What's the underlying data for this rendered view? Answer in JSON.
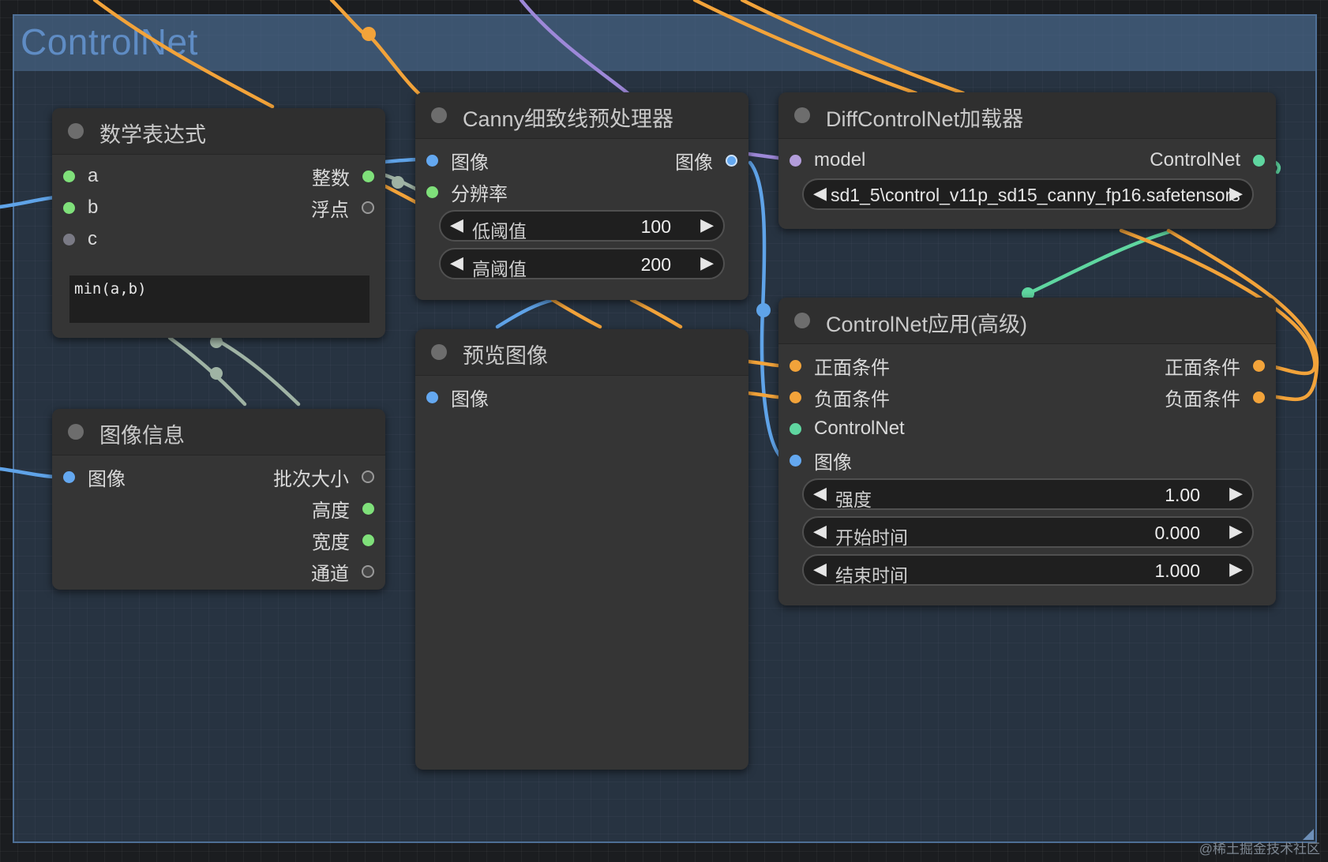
{
  "colors": {
    "background": "#1b1d20",
    "group_fill": "#3c5878",
    "group_title": "#5f8cc4",
    "node_body": "#353535",
    "node_header": "#2f2f2f",
    "slot_int": "#7fe07a",
    "slot_float": "#454545",
    "slot_image": "#64a8f0",
    "slot_model": "#b39ddb",
    "slot_conditioning": "#f2a33a",
    "slot_controlnet": "#5fd6a0",
    "wire_orange": "#f2a33a",
    "wire_purple": "#9d88d8",
    "wire_blue": "#5fa3e8",
    "wire_green": "#5fd6a0",
    "wire_gray": "#9fb3a4"
  },
  "group": {
    "title": "ControlNet"
  },
  "nodes": {
    "math": {
      "title": "数学表达式",
      "inputs": [
        {
          "label": "a",
          "type": "int"
        },
        {
          "label": "b",
          "type": "int"
        },
        {
          "label": "c",
          "type": "none"
        }
      ],
      "outputs": [
        {
          "label": "整数",
          "type": "int"
        },
        {
          "label": "浮点",
          "type": "float"
        }
      ],
      "expression": "min(a,b)"
    },
    "imageinfo": {
      "title": "图像信息",
      "inputs": [
        {
          "label": "图像",
          "type": "image"
        }
      ],
      "outputs": [
        {
          "label": "批次大小",
          "type": "float"
        },
        {
          "label": "高度",
          "type": "int"
        },
        {
          "label": "宽度",
          "type": "int"
        },
        {
          "label": "通道",
          "type": "float"
        }
      ]
    },
    "canny": {
      "title": "Canny细致线预处理器",
      "inputs": [
        {
          "label": "图像",
          "type": "image"
        },
        {
          "label": "分辨率",
          "type": "int"
        }
      ],
      "outputs": [
        {
          "label": "图像",
          "type": "image"
        }
      ],
      "widgets": [
        {
          "label": "低阈值",
          "value": "100"
        },
        {
          "label": "高阈值",
          "value": "200"
        }
      ]
    },
    "preview": {
      "title": "预览图像",
      "inputs": [
        {
          "label": "图像",
          "type": "image"
        }
      ]
    },
    "diffloader": {
      "title": "DiffControlNet加载器",
      "inputs": [
        {
          "label": "model",
          "type": "model"
        }
      ],
      "outputs": [
        {
          "label": "ControlNet",
          "type": "controlnet"
        }
      ],
      "combo_value": "sd1_5\\control_v11p_sd15_canny_fp16.safetensors"
    },
    "apply": {
      "title": "ControlNet应用(高级)",
      "inputs": [
        {
          "label": "正面条件",
          "type": "conditioning"
        },
        {
          "label": "负面条件",
          "type": "conditioning"
        },
        {
          "label": "ControlNet",
          "type": "controlnet"
        },
        {
          "label": "图像",
          "type": "image"
        }
      ],
      "outputs": [
        {
          "label": "正面条件",
          "type": "conditioning"
        },
        {
          "label": "负面条件",
          "type": "conditioning"
        }
      ],
      "widgets": [
        {
          "label": "强度",
          "value": "1.00"
        },
        {
          "label": "开始时间",
          "value": "0.000"
        },
        {
          "label": "结束时间",
          "value": "1.000"
        }
      ]
    }
  },
  "widget_arrows": {
    "left": "◀",
    "right": "▶"
  },
  "watermark": "@稀土掘金技术社区"
}
